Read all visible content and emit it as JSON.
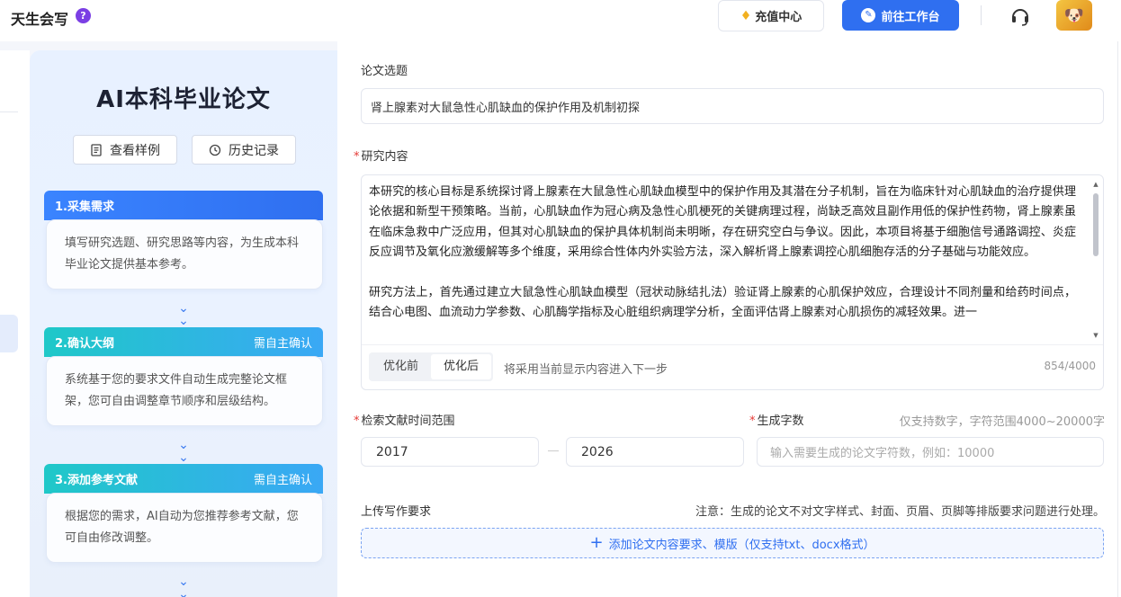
{
  "app": {
    "brand": "天生会写",
    "help_icon": "?"
  },
  "header": {
    "recharge_label": "充值中心",
    "workbench_label": "前往工作台",
    "support_icon": "headset-icon",
    "avatar_icon": "avatar-icon",
    "accent": "#2f6ff0"
  },
  "steps_panel": {
    "title": "AI本科毕业论文",
    "view_sample_label": "查看样例",
    "history_label": "历史记录",
    "steps": [
      {
        "title": "1.采集需求",
        "tag": "",
        "desc": "填写研究选题、研究思路等内容，为生成本科毕业论文提供基本参考。"
      },
      {
        "title": "2.确认大纲",
        "tag": "需自主确认",
        "desc": "系统基于您的要求文件自动生成完整论文框架，您可自由调整章节顺序和层级结构。"
      },
      {
        "title": "3.添加参考文献",
        "tag": "需自主确认",
        "desc": "根据您的需求，AI自动为您推荐参考文献，您可自由修改调整。"
      }
    ]
  },
  "form": {
    "topic_label": "论文选题",
    "topic_value": "肾上腺素对大鼠急性心肌缺血的保护作用及机制初探",
    "content_label": "研究内容",
    "required_mark": "*",
    "content_paragraphs": [
      "本研究的核心目标是系统探讨肾上腺素在大鼠急性心肌缺血模型中的保护作用及其潜在分子机制，旨在为临床针对心肌缺血的治疗提供理论依据和新型干预策略。当前，心肌缺血作为冠心病及急性心肌梗死的关键病理过程，尚缺乏高效且副作用低的保护性药物，肾上腺素虽在临床急救中广泛应用，但其对心肌缺血的保护具体机制尚未明晰，存在研究空白与争议。因此，本项目将基于细胞信号通路调控、炎症反应调节及氧化应激缓解等多个维度，采用综合性体内外实验方法，深入解析肾上腺素调控心肌细胞存活的分子基础与功能效应。",
      "研究方法上，首先通过建立大鼠急性心肌缺血模型（冠状动脉结扎法）验证肾上腺素的心肌保护效应，合理设计不同剂量和给药时间点，结合心电图、血流动力学参数、心肌酶学指标及心脏组织病理学分析，全面评估肾上腺素对心肌损伤的减轻效果。进一"
    ],
    "tab_before": "优化前",
    "tab_after": "优化后",
    "content_hint": "将采用当前显示内容进入下一步",
    "char_count": "854/4000",
    "date_range_label": "检索文献时间范围",
    "year_start": "2017",
    "year_end": "2026",
    "word_count_label": "生成字数",
    "word_count_hint": "仅支持数字，字符范围4000~20000字",
    "word_count_placeholder": "输入需要生成的论文字符数，例如：10000",
    "upload_label": "上传写作要求",
    "upload_note": "注意：生成的论文不对文字样式、封面、页眉、页脚等排版要求问题进行处理。",
    "upload_button": "添加论文内容要求、模版（仅支持txt、docx格式）"
  }
}
